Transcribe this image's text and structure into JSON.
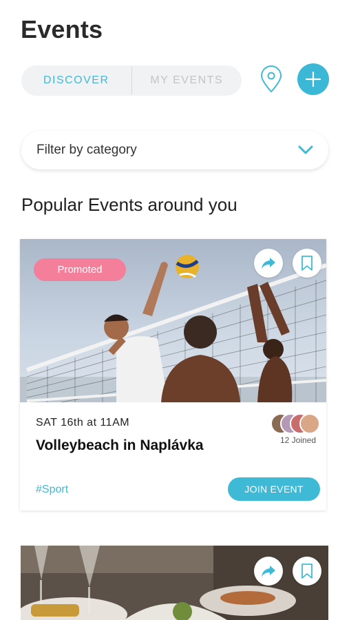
{
  "header": {
    "title": "Events"
  },
  "tabs": {
    "discover": "DISCOVER",
    "my_events": "MY EVENTS",
    "active": "discover"
  },
  "icons": {
    "location": "map-pin-icon",
    "add": "plus-icon",
    "chevron": "chevron-down-icon",
    "share": "share-arrow-icon",
    "bookmark": "bookmark-icon"
  },
  "filter": {
    "label": "Filter by category"
  },
  "section": {
    "title": "Popular Events around you"
  },
  "events": [
    {
      "badge": "Promoted",
      "date": "SAT 16th at 11AM",
      "title": "Volleybeach in Naplávka",
      "joined": "12 Joined",
      "tag": "#Sport",
      "join_label": "JOIN EVENT"
    }
  ],
  "colors": {
    "accent": "#3ebad7",
    "promoted": "#f37f9b"
  }
}
